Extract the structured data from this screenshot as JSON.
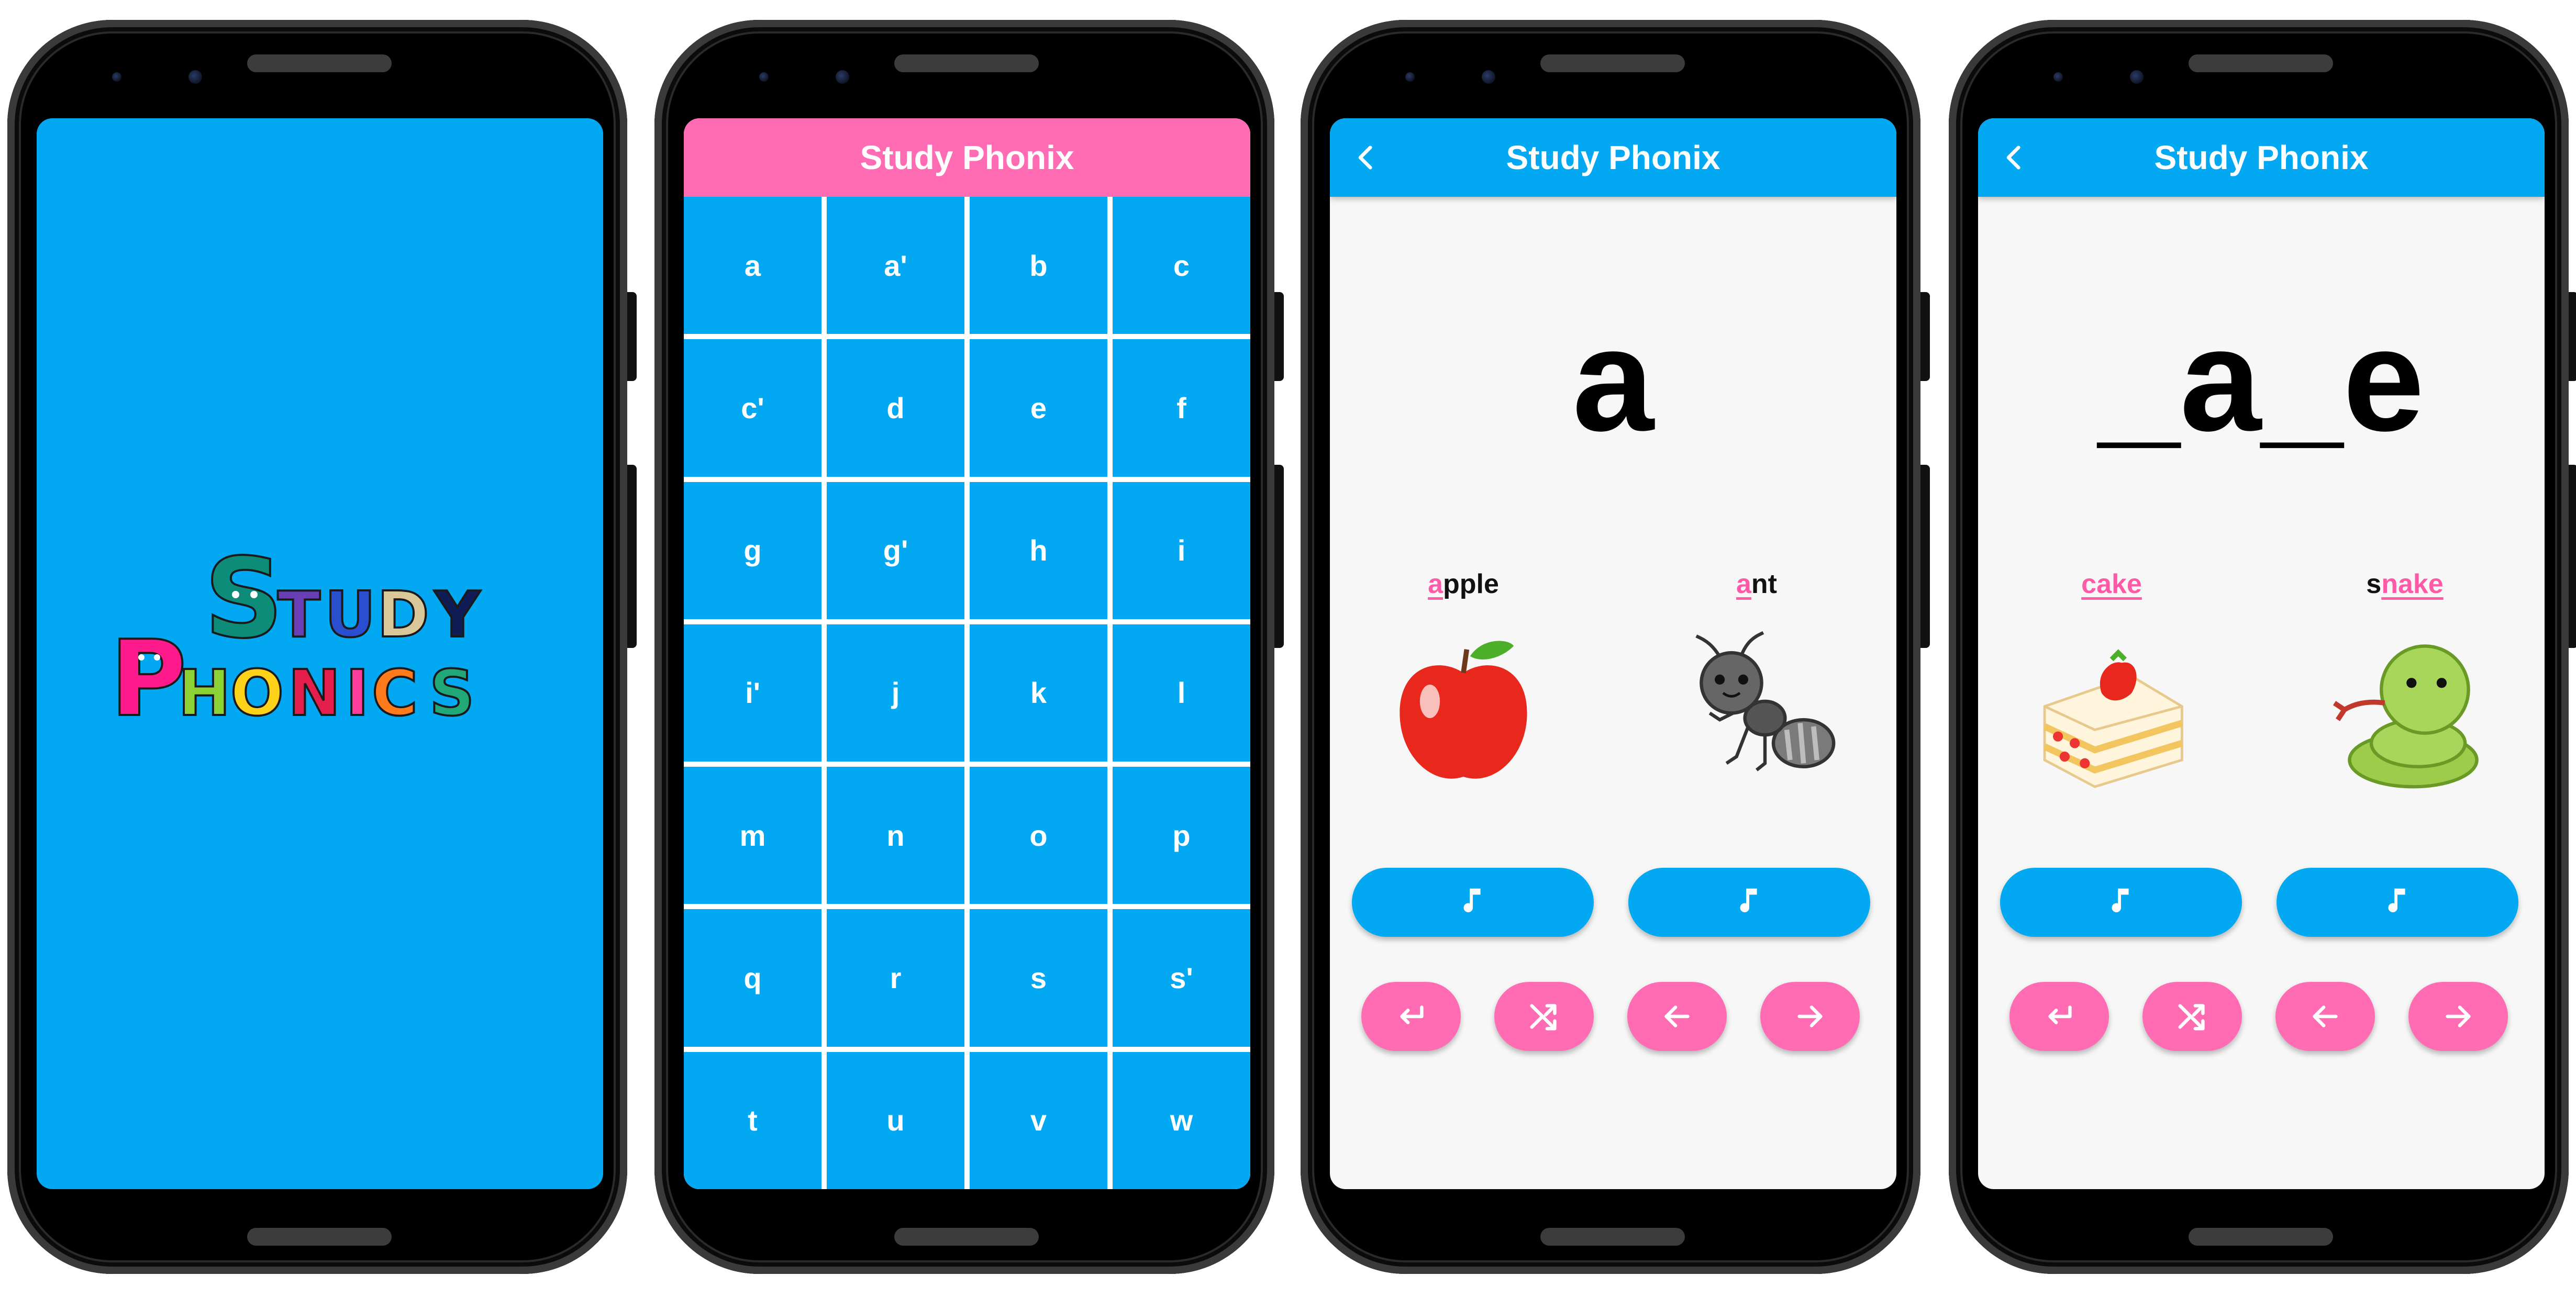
{
  "splash": {
    "logo_line1": "STUDY",
    "logo_line2": "PHONICS",
    "background": "#03a8f2"
  },
  "grid": {
    "title": "Study Phonix",
    "header_color": "#ff6cb4",
    "cell_color": "#03a8f2",
    "letters": [
      "a",
      "a'",
      "b",
      "c",
      "c'",
      "d",
      "e",
      "f",
      "g",
      "g'",
      "h",
      "i",
      "i'",
      "j",
      "k",
      "l",
      "m",
      "n",
      "o",
      "p",
      "q",
      "r",
      "s",
      "s'",
      "t",
      "u",
      "v",
      "w"
    ]
  },
  "study1": {
    "title": "Study Phonix",
    "letter": "a",
    "left_word": {
      "highlight": "a",
      "rest": "pple",
      "picture": "apple-illustration"
    },
    "right_word": {
      "highlight": "a",
      "rest": "nt",
      "picture": "ant-illustration"
    }
  },
  "study2": {
    "title": "Study Phonix",
    "letter": "_a_e",
    "left_word": {
      "prefix": "",
      "highlight": "cake",
      "picture": "cake-illustration"
    },
    "right_word": {
      "prefix": "s",
      "highlight": "nake",
      "picture": "snake-illustration"
    }
  },
  "icons": {
    "back": "chevron-left-icon",
    "sound": "music-note-icon",
    "return": "return-icon",
    "shuffle": "shuffle-icon",
    "previous": "arrow-left-icon",
    "next": "arrow-right-icon"
  },
  "colors": {
    "accent_blue": "#03a8f2",
    "accent_pink": "#ff6cb4",
    "highlight_pink": "#ff5aa8"
  }
}
